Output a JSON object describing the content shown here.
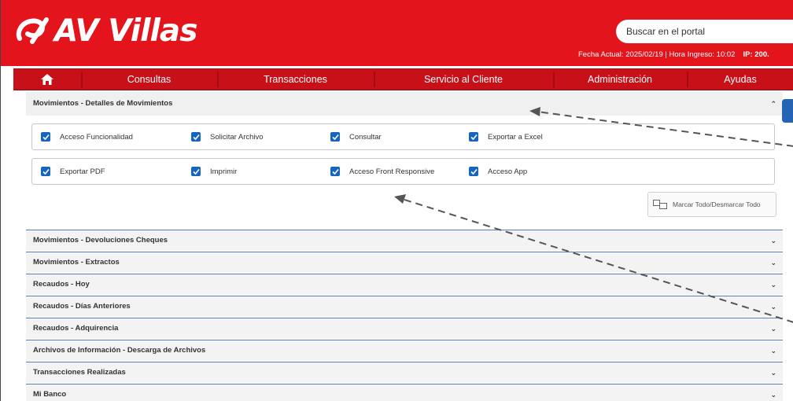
{
  "header": {
    "brand": "AV Villas",
    "search_placeholder": "Buscar en el portal",
    "info": "Fecha Actual: 2025/02/19 | Hora Ingreso: 10:02",
    "ip": "IP: 200.",
    "brand_color": "#e3141c"
  },
  "nav": {
    "home_icon": "home-icon",
    "items": [
      "Consultas",
      "Transacciones",
      "Servicio al Cliente",
      "Administración",
      "Ayudas"
    ]
  },
  "section": {
    "title": "Movimientos - Detalles de Movimientos",
    "expanded": true,
    "row1": [
      "Acceso Funcionalidad",
      "Solicitar Archivo",
      "Consultar",
      "Exportar a Excel"
    ],
    "row2": [
      "Exportar PDF",
      "Imprimir",
      "Acceso Front Responsive",
      "Acceso App"
    ],
    "all_checked": true,
    "mark_all_label": "Marcar Todo/Desmarcar Todo"
  },
  "accordion": [
    "Movimientos - Devoluciones Cheques",
    "Movimientos - Extractos",
    "Recaudos - Hoy",
    "Recaudos - Días Anteriores",
    "Recaudos - Adquirencia",
    "Archivos de Información - Descarga de Archivos",
    "Transacciones Realizadas",
    "Mi Banco"
  ]
}
